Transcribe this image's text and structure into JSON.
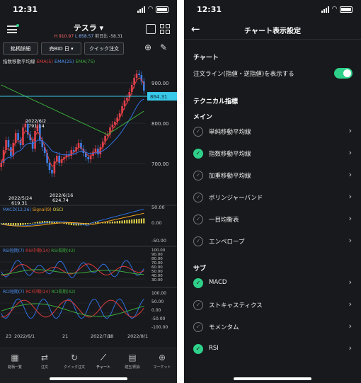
{
  "status": {
    "time": "12:31"
  },
  "left": {
    "stock_name": "テスラ",
    "quote": {
      "high": "H 910.97",
      "low": "L 858.57",
      "change": "前日比 -58.31"
    },
    "toolbar": {
      "detail": "銘柄詳細",
      "sell_bid": "売BID 日",
      "quick_order": "クイック注文"
    },
    "chart": {
      "legend": {
        "title": "指数移動平均線",
        "ema5": "EMA(5)",
        "ema25": "EMA(25)",
        "ema75": "EMA(75)"
      },
      "price_labels": [
        "900.00",
        "800.00",
        "700.00"
      ],
      "current_price": "864.31",
      "annotations": [
        {
          "date": "2022/6/2",
          "price": "791.14"
        },
        {
          "date": "2022/5/24",
          "price": "619.31"
        },
        {
          "date": "2022/6/16",
          "price": "624.74"
        }
      ],
      "macd": {
        "legend": "MACD(12,26)",
        "signal": "Signal(9)",
        "osci": "OSCI",
        "labels": [
          "50.00",
          "0.00",
          "-50.00"
        ]
      },
      "rsi1": {
        "legend_s": "RSI短期(7)",
        "legend_m": "RSI中期(14)",
        "legend_l": "RSI長期(42)",
        "labels": [
          "100.00",
          "90.00",
          "80.00",
          "70.00",
          "60.00",
          "50.00",
          "40.00",
          "30.00"
        ]
      },
      "rci": {
        "legend_s": "RCI短期(7)",
        "legend_m": "RCI中期(14)",
        "legend_l": "RCI長期(42)",
        "labels": [
          "100.00",
          "50.00",
          "0.00",
          "-50.00",
          "-100.00"
        ]
      },
      "x_labels": [
        "23",
        "2022/6/1",
        "21",
        "2022/7/1",
        "18",
        "2022/8/1"
      ],
      "colors": {
        "up": "#e0414d",
        "down": "#3f7fe8",
        "ema5": "#e03b3b",
        "ema25": "#2f6fe0",
        "ema75": "#3caa3c",
        "signal": "#f0a020",
        "osci": "#e8d84a",
        "price_line": "#38c8e8"
      }
    },
    "tabs": [
      {
        "icon": "grid",
        "label": "銘柄一覧"
      },
      {
        "icon": "swap",
        "label": "注文"
      },
      {
        "icon": "refresh",
        "label": "クイック注文"
      },
      {
        "icon": "chart",
        "label": "チャート"
      },
      {
        "icon": "doc",
        "label": "建玉/照会"
      },
      {
        "icon": "globe",
        "label": "マーケット"
      }
    ]
  },
  "right": {
    "title": "チャート表示設定",
    "chart_section": "チャート",
    "order_line_label": "注文ライン(指値・逆指値)を表示する",
    "order_line_on": true,
    "tech_section": "テクニカル指標",
    "main_section": "メイン",
    "main_items": [
      {
        "label": "単純移動平均線",
        "checked": false
      },
      {
        "label": "指数移動平均線",
        "checked": true
      },
      {
        "label": "加重移動平均線",
        "checked": false
      },
      {
        "label": "ボリンジャーバンド",
        "checked": false
      },
      {
        "label": "一目均衡表",
        "checked": false
      },
      {
        "label": "エンベロープ",
        "checked": false
      }
    ],
    "sub_section": "サブ",
    "sub_items": [
      {
        "label": "MACD",
        "checked": true
      },
      {
        "label": "ストキャスティクス",
        "checked": false
      },
      {
        "label": "モメンタム",
        "checked": false
      },
      {
        "label": "RSI",
        "checked": true
      }
    ]
  }
}
